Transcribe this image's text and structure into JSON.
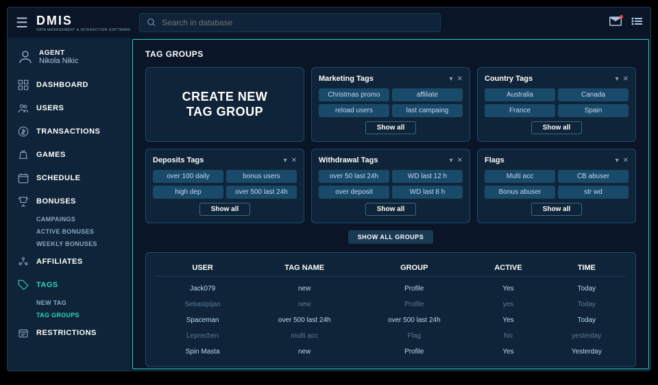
{
  "logo": {
    "main": "DMIS",
    "sub": "DATA MANAGEMENT & INTERACTION SOFTWARE"
  },
  "search": {
    "placeholder": "Search in database"
  },
  "agent": {
    "label": "AGENT",
    "name": "Nikola Nikic"
  },
  "nav": [
    {
      "label": "DASHBOARD"
    },
    {
      "label": "USERS"
    },
    {
      "label": "TRANSACTIONS"
    },
    {
      "label": "GAMES"
    },
    {
      "label": "SCHEDULE"
    },
    {
      "label": "BONUSES",
      "subs": [
        "CAMPAINGS",
        "ACTIVE BONUSES",
        "WEEKLY BONUSES"
      ]
    },
    {
      "label": "AFFILIATES"
    },
    {
      "label": "TAGS",
      "active": true,
      "subs": [
        "NEW TAG",
        "TAG GROUPS"
      ],
      "activeSub": 1
    },
    {
      "label": "RESTRICTIONS"
    }
  ],
  "page": {
    "title": "TAG GROUPS",
    "create": "CREATE NEW TAG GROUP",
    "showAll": "Show all",
    "showGroups": "SHOW ALL GROUPS"
  },
  "groups": [
    {
      "title": "Marketing Tags",
      "tags": [
        "Christmas promo",
        "affiliate",
        "reload users",
        "last campaing"
      ]
    },
    {
      "title": "Country Tags",
      "tags": [
        "Australia",
        "Canada",
        "France",
        "Spain"
      ]
    },
    {
      "title": "Deposits Tags",
      "tags": [
        "over 100 daily",
        "bonus users",
        "high dep",
        "over 500 last 24h"
      ]
    },
    {
      "title": "Withdrawal Tags",
      "tags": [
        "over 50 last 24h",
        "WD last 12 h",
        "over deposit",
        "WD last 8 h"
      ]
    },
    {
      "title": "Flags",
      "tags": [
        "Multi acc",
        "CB abuser",
        "Bonus abuser",
        "str wd"
      ]
    }
  ],
  "table": {
    "headers": [
      "USER",
      "TAG NAME",
      "GROUP",
      "ACTIVE",
      "TIME"
    ],
    "rows": [
      {
        "c": [
          "Jack079",
          "new",
          "Profile",
          "Yes",
          "Today"
        ]
      },
      {
        "c": [
          "Sebastpijan",
          "new",
          "Profile",
          "yes",
          "Today"
        ],
        "muted": true
      },
      {
        "c": [
          "Spaceman",
          "over 500 last 24h",
          "over 500 last 24h",
          "Yes",
          "Today"
        ]
      },
      {
        "c": [
          "Leprechen",
          "multi acc",
          "Flag",
          "No",
          "yesterday"
        ],
        "muted": true
      },
      {
        "c": [
          "Spin Masta",
          "new",
          "Profile",
          "Yes",
          "Yesterday"
        ]
      }
    ]
  }
}
